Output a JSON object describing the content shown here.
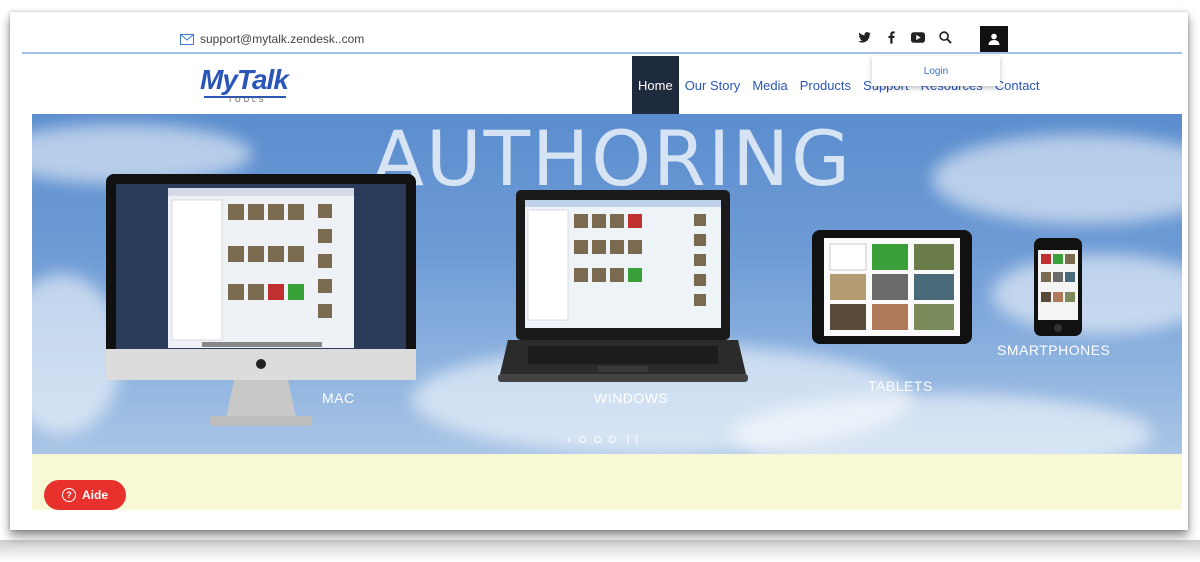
{
  "topbar": {
    "support_email": "support@mytalk.zendesk..com",
    "social_icons": [
      "twitter-icon",
      "facebook-icon",
      "youtube-icon",
      "search-icon",
      "user-icon"
    ]
  },
  "dropdown": {
    "login_label": "Login"
  },
  "logo": {
    "main": "MyTalk",
    "sub": "TOOLS"
  },
  "nav": {
    "items": [
      {
        "label": "Home",
        "active": true
      },
      {
        "label": "Our Story"
      },
      {
        "label": "Media"
      },
      {
        "label": "Products"
      },
      {
        "label": "Support"
      },
      {
        "label": "Resources"
      },
      {
        "label": "Contact"
      }
    ]
  },
  "hero": {
    "headline": "AUTHORING",
    "captions": {
      "mac": "MAC",
      "windows": "WINDOWS",
      "tablets": "TABLETS",
      "smartphones": "SMARTPHONES"
    },
    "slider_arrow": "›",
    "slide_count": 3
  },
  "help_button": {
    "label": "Aide",
    "icon": "?"
  },
  "colors": {
    "accent": "#2a56b8",
    "nav_active_bg": "#1e2b3c",
    "help_red": "#e8312c",
    "footer_band": "#f9f8d6"
  }
}
